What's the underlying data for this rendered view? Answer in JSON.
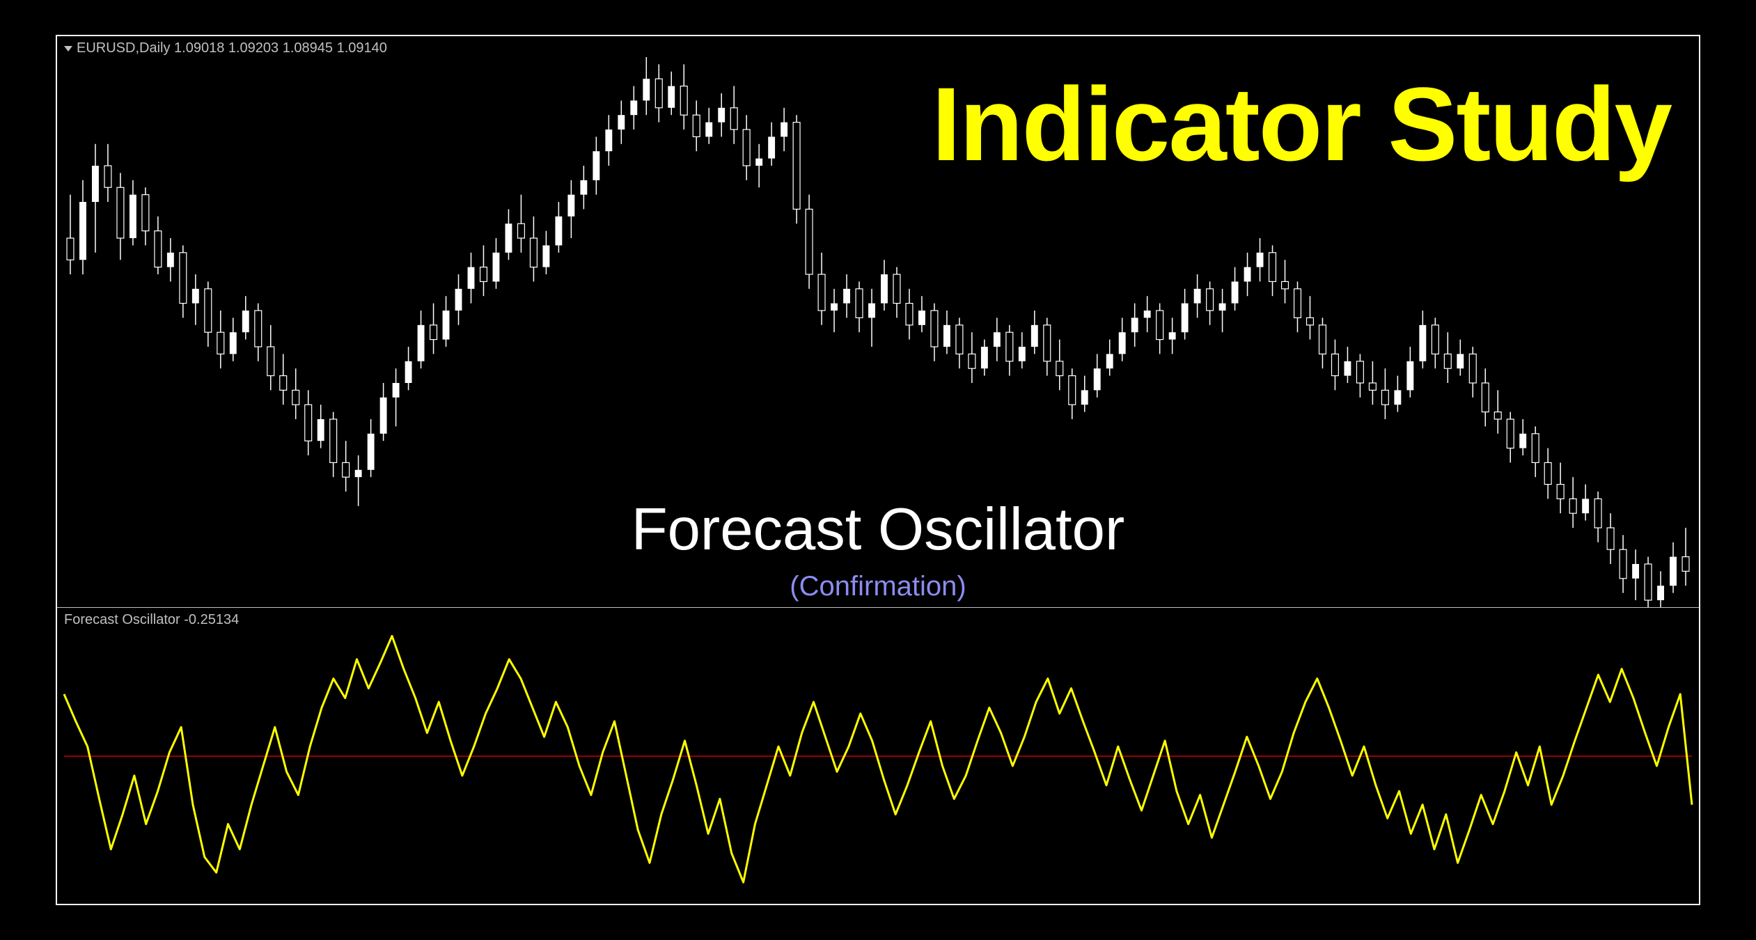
{
  "chart_data": {
    "type": "line",
    "title": "Indicator Study",
    "indicator_name": "Forecast Oscillator",
    "indicator_tag": "(Confirmation)",
    "price_pane": {
      "label": "EURUSD,Daily  1.09018 1.09203 1.08945 1.09140",
      "symbol": "EURUSD",
      "timeframe": "Daily",
      "ohlc": {
        "o": 1.09018,
        "h": 1.09203,
        "l": 1.08945,
        "c": 1.0914
      },
      "yrange_est": [
        1.05,
        1.125
      ],
      "candles": [
        {
          "o": 1.1,
          "h": 1.106,
          "l": 1.095,
          "c": 1.097
        },
        {
          "o": 1.097,
          "h": 1.108,
          "l": 1.095,
          "c": 1.105
        },
        {
          "o": 1.105,
          "h": 1.113,
          "l": 1.098,
          "c": 1.11
        },
        {
          "o": 1.11,
          "h": 1.113,
          "l": 1.105,
          "c": 1.107
        },
        {
          "o": 1.107,
          "h": 1.109,
          "l": 1.097,
          "c": 1.1
        },
        {
          "o": 1.1,
          "h": 1.108,
          "l": 1.099,
          "c": 1.106
        },
        {
          "o": 1.106,
          "h": 1.107,
          "l": 1.099,
          "c": 1.101
        },
        {
          "o": 1.101,
          "h": 1.103,
          "l": 1.095,
          "c": 1.096
        },
        {
          "o": 1.096,
          "h": 1.1,
          "l": 1.094,
          "c": 1.098
        },
        {
          "o": 1.098,
          "h": 1.099,
          "l": 1.089,
          "c": 1.091
        },
        {
          "o": 1.091,
          "h": 1.095,
          "l": 1.088,
          "c": 1.093
        },
        {
          "o": 1.093,
          "h": 1.094,
          "l": 1.085,
          "c": 1.087
        },
        {
          "o": 1.087,
          "h": 1.09,
          "l": 1.082,
          "c": 1.084
        },
        {
          "o": 1.084,
          "h": 1.089,
          "l": 1.083,
          "c": 1.087
        },
        {
          "o": 1.087,
          "h": 1.092,
          "l": 1.086,
          "c": 1.09
        },
        {
          "o": 1.09,
          "h": 1.091,
          "l": 1.083,
          "c": 1.085
        },
        {
          "o": 1.085,
          "h": 1.088,
          "l": 1.079,
          "c": 1.081
        },
        {
          "o": 1.081,
          "h": 1.084,
          "l": 1.077,
          "c": 1.079
        },
        {
          "o": 1.079,
          "h": 1.082,
          "l": 1.075,
          "c": 1.077
        },
        {
          "o": 1.077,
          "h": 1.079,
          "l": 1.07,
          "c": 1.072
        },
        {
          "o": 1.072,
          "h": 1.077,
          "l": 1.071,
          "c": 1.075
        },
        {
          "o": 1.075,
          "h": 1.076,
          "l": 1.067,
          "c": 1.069
        },
        {
          "o": 1.069,
          "h": 1.072,
          "l": 1.065,
          "c": 1.067
        },
        {
          "o": 1.067,
          "h": 1.07,
          "l": 1.063,
          "c": 1.068
        },
        {
          "o": 1.068,
          "h": 1.075,
          "l": 1.067,
          "c": 1.073
        },
        {
          "o": 1.073,
          "h": 1.08,
          "l": 1.072,
          "c": 1.078
        },
        {
          "o": 1.078,
          "h": 1.082,
          "l": 1.074,
          "c": 1.08
        },
        {
          "o": 1.08,
          "h": 1.085,
          "l": 1.079,
          "c": 1.083
        },
        {
          "o": 1.083,
          "h": 1.09,
          "l": 1.082,
          "c": 1.088
        },
        {
          "o": 1.088,
          "h": 1.091,
          "l": 1.084,
          "c": 1.086
        },
        {
          "o": 1.086,
          "h": 1.092,
          "l": 1.085,
          "c": 1.09
        },
        {
          "o": 1.09,
          "h": 1.095,
          "l": 1.088,
          "c": 1.093
        },
        {
          "o": 1.093,
          "h": 1.098,
          "l": 1.091,
          "c": 1.096
        },
        {
          "o": 1.096,
          "h": 1.099,
          "l": 1.092,
          "c": 1.094
        },
        {
          "o": 1.094,
          "h": 1.1,
          "l": 1.093,
          "c": 1.098
        },
        {
          "o": 1.098,
          "h": 1.104,
          "l": 1.097,
          "c": 1.102
        },
        {
          "o": 1.102,
          "h": 1.106,
          "l": 1.098,
          "c": 1.1
        },
        {
          "o": 1.1,
          "h": 1.103,
          "l": 1.094,
          "c": 1.096
        },
        {
          "o": 1.096,
          "h": 1.101,
          "l": 1.095,
          "c": 1.099
        },
        {
          "o": 1.099,
          "h": 1.105,
          "l": 1.098,
          "c": 1.103
        },
        {
          "o": 1.103,
          "h": 1.108,
          "l": 1.1,
          "c": 1.106
        },
        {
          "o": 1.106,
          "h": 1.11,
          "l": 1.104,
          "c": 1.108
        },
        {
          "o": 1.108,
          "h": 1.114,
          "l": 1.106,
          "c": 1.112
        },
        {
          "o": 1.112,
          "h": 1.117,
          "l": 1.11,
          "c": 1.115
        },
        {
          "o": 1.115,
          "h": 1.119,
          "l": 1.113,
          "c": 1.117
        },
        {
          "o": 1.117,
          "h": 1.121,
          "l": 1.115,
          "c": 1.119
        },
        {
          "o": 1.119,
          "h": 1.125,
          "l": 1.117,
          "c": 1.122
        },
        {
          "o": 1.122,
          "h": 1.124,
          "l": 1.116,
          "c": 1.118
        },
        {
          "o": 1.118,
          "h": 1.123,
          "l": 1.117,
          "c": 1.121
        },
        {
          "o": 1.121,
          "h": 1.124,
          "l": 1.115,
          "c": 1.117
        },
        {
          "o": 1.117,
          "h": 1.119,
          "l": 1.112,
          "c": 1.114
        },
        {
          "o": 1.114,
          "h": 1.118,
          "l": 1.113,
          "c": 1.116
        },
        {
          "o": 1.116,
          "h": 1.12,
          "l": 1.114,
          "c": 1.118
        },
        {
          "o": 1.118,
          "h": 1.121,
          "l": 1.113,
          "c": 1.115
        },
        {
          "o": 1.115,
          "h": 1.117,
          "l": 1.108,
          "c": 1.11
        },
        {
          "o": 1.11,
          "h": 1.113,
          "l": 1.107,
          "c": 1.111
        },
        {
          "o": 1.111,
          "h": 1.116,
          "l": 1.11,
          "c": 1.114
        },
        {
          "o": 1.114,
          "h": 1.118,
          "l": 1.112,
          "c": 1.116
        },
        {
          "o": 1.116,
          "h": 1.117,
          "l": 1.102,
          "c": 1.104
        },
        {
          "o": 1.104,
          "h": 1.106,
          "l": 1.093,
          "c": 1.095
        },
        {
          "o": 1.095,
          "h": 1.098,
          "l": 1.088,
          "c": 1.09
        },
        {
          "o": 1.09,
          "h": 1.093,
          "l": 1.087,
          "c": 1.091
        },
        {
          "o": 1.091,
          "h": 1.095,
          "l": 1.089,
          "c": 1.093
        },
        {
          "o": 1.093,
          "h": 1.094,
          "l": 1.087,
          "c": 1.089
        },
        {
          "o": 1.089,
          "h": 1.093,
          "l": 1.085,
          "c": 1.091
        },
        {
          "o": 1.091,
          "h": 1.097,
          "l": 1.09,
          "c": 1.095
        },
        {
          "o": 1.095,
          "h": 1.096,
          "l": 1.089,
          "c": 1.091
        },
        {
          "o": 1.091,
          "h": 1.093,
          "l": 1.086,
          "c": 1.088
        },
        {
          "o": 1.088,
          "h": 1.092,
          "l": 1.087,
          "c": 1.09
        },
        {
          "o": 1.09,
          "h": 1.091,
          "l": 1.083,
          "c": 1.085
        },
        {
          "o": 1.085,
          "h": 1.09,
          "l": 1.084,
          "c": 1.088
        },
        {
          "o": 1.088,
          "h": 1.089,
          "l": 1.082,
          "c": 1.084
        },
        {
          "o": 1.084,
          "h": 1.087,
          "l": 1.08,
          "c": 1.082
        },
        {
          "o": 1.082,
          "h": 1.086,
          "l": 1.081,
          "c": 1.085
        },
        {
          "o": 1.085,
          "h": 1.089,
          "l": 1.083,
          "c": 1.087
        },
        {
          "o": 1.087,
          "h": 1.088,
          "l": 1.081,
          "c": 1.083
        },
        {
          "o": 1.083,
          "h": 1.087,
          "l": 1.082,
          "c": 1.085
        },
        {
          "o": 1.085,
          "h": 1.09,
          "l": 1.084,
          "c": 1.088
        },
        {
          "o": 1.088,
          "h": 1.089,
          "l": 1.081,
          "c": 1.083
        },
        {
          "o": 1.083,
          "h": 1.086,
          "l": 1.079,
          "c": 1.081
        },
        {
          "o": 1.081,
          "h": 1.082,
          "l": 1.075,
          "c": 1.077
        },
        {
          "o": 1.077,
          "h": 1.081,
          "l": 1.076,
          "c": 1.079
        },
        {
          "o": 1.079,
          "h": 1.084,
          "l": 1.078,
          "c": 1.082
        },
        {
          "o": 1.082,
          "h": 1.086,
          "l": 1.081,
          "c": 1.084
        },
        {
          "o": 1.084,
          "h": 1.089,
          "l": 1.083,
          "c": 1.087
        },
        {
          "o": 1.087,
          "h": 1.091,
          "l": 1.085,
          "c": 1.089
        },
        {
          "o": 1.089,
          "h": 1.092,
          "l": 1.087,
          "c": 1.09
        },
        {
          "o": 1.09,
          "h": 1.091,
          "l": 1.084,
          "c": 1.086
        },
        {
          "o": 1.086,
          "h": 1.089,
          "l": 1.084,
          "c": 1.087
        },
        {
          "o": 1.087,
          "h": 1.093,
          "l": 1.086,
          "c": 1.091
        },
        {
          "o": 1.091,
          "h": 1.095,
          "l": 1.089,
          "c": 1.093
        },
        {
          "o": 1.093,
          "h": 1.094,
          "l": 1.088,
          "c": 1.09
        },
        {
          "o": 1.09,
          "h": 1.093,
          "l": 1.087,
          "c": 1.091
        },
        {
          "o": 1.091,
          "h": 1.096,
          "l": 1.09,
          "c": 1.094
        },
        {
          "o": 1.094,
          "h": 1.098,
          "l": 1.092,
          "c": 1.096
        },
        {
          "o": 1.096,
          "h": 1.1,
          "l": 1.094,
          "c": 1.098
        },
        {
          "o": 1.098,
          "h": 1.099,
          "l": 1.092,
          "c": 1.094
        },
        {
          "o": 1.094,
          "h": 1.097,
          "l": 1.091,
          "c": 1.093
        },
        {
          "o": 1.093,
          "h": 1.094,
          "l": 1.087,
          "c": 1.089
        },
        {
          "o": 1.089,
          "h": 1.092,
          "l": 1.086,
          "c": 1.088
        },
        {
          "o": 1.088,
          "h": 1.089,
          "l": 1.082,
          "c": 1.084
        },
        {
          "o": 1.084,
          "h": 1.086,
          "l": 1.079,
          "c": 1.081
        },
        {
          "o": 1.081,
          "h": 1.085,
          "l": 1.08,
          "c": 1.083
        },
        {
          "o": 1.083,
          "h": 1.084,
          "l": 1.078,
          "c": 1.08
        },
        {
          "o": 1.08,
          "h": 1.083,
          "l": 1.077,
          "c": 1.079
        },
        {
          "o": 1.079,
          "h": 1.082,
          "l": 1.075,
          "c": 1.077
        },
        {
          "o": 1.077,
          "h": 1.081,
          "l": 1.076,
          "c": 1.079
        },
        {
          "o": 1.079,
          "h": 1.085,
          "l": 1.078,
          "c": 1.083
        },
        {
          "o": 1.083,
          "h": 1.09,
          "l": 1.082,
          "c": 1.088
        },
        {
          "o": 1.088,
          "h": 1.089,
          "l": 1.082,
          "c": 1.084
        },
        {
          "o": 1.084,
          "h": 1.087,
          "l": 1.08,
          "c": 1.082
        },
        {
          "o": 1.082,
          "h": 1.086,
          "l": 1.081,
          "c": 1.084
        },
        {
          "o": 1.084,
          "h": 1.085,
          "l": 1.078,
          "c": 1.08
        },
        {
          "o": 1.08,
          "h": 1.082,
          "l": 1.074,
          "c": 1.076
        },
        {
          "o": 1.076,
          "h": 1.079,
          "l": 1.073,
          "c": 1.075
        },
        {
          "o": 1.075,
          "h": 1.076,
          "l": 1.069,
          "c": 1.071
        },
        {
          "o": 1.071,
          "h": 1.075,
          "l": 1.07,
          "c": 1.073
        },
        {
          "o": 1.073,
          "h": 1.074,
          "l": 1.067,
          "c": 1.069
        },
        {
          "o": 1.069,
          "h": 1.071,
          "l": 1.064,
          "c": 1.066
        },
        {
          "o": 1.066,
          "h": 1.069,
          "l": 1.062,
          "c": 1.064
        },
        {
          "o": 1.064,
          "h": 1.067,
          "l": 1.06,
          "c": 1.062
        },
        {
          "o": 1.062,
          "h": 1.066,
          "l": 1.061,
          "c": 1.064
        },
        {
          "o": 1.064,
          "h": 1.065,
          "l": 1.058,
          "c": 1.06
        },
        {
          "o": 1.06,
          "h": 1.062,
          "l": 1.055,
          "c": 1.057
        },
        {
          "o": 1.057,
          "h": 1.059,
          "l": 1.051,
          "c": 1.053
        },
        {
          "o": 1.053,
          "h": 1.057,
          "l": 1.05,
          "c": 1.055
        },
        {
          "o": 1.055,
          "h": 1.056,
          "l": 1.048,
          "c": 1.05
        },
        {
          "o": 1.05,
          "h": 1.054,
          "l": 1.049,
          "c": 1.052
        },
        {
          "o": 1.052,
          "h": 1.058,
          "l": 1.051,
          "c": 1.056
        },
        {
          "o": 1.056,
          "h": 1.06,
          "l": 1.052,
          "c": 1.054
        }
      ]
    },
    "indicator_pane": {
      "label": "Forecast Oscillator -0.25134",
      "name": "Forecast Oscillator",
      "current_value": -0.25134,
      "zero_line": 0,
      "yrange_est": [
        -0.7,
        0.65
      ],
      "values": [
        0.32,
        0.18,
        0.05,
        -0.22,
        -0.48,
        -0.3,
        -0.1,
        -0.35,
        -0.18,
        0.02,
        0.15,
        -0.25,
        -0.52,
        -0.6,
        -0.35,
        -0.48,
        -0.25,
        -0.05,
        0.15,
        -0.08,
        -0.2,
        0.05,
        0.25,
        0.4,
        0.3,
        0.5,
        0.35,
        0.48,
        0.62,
        0.45,
        0.3,
        0.12,
        0.28,
        0.08,
        -0.1,
        0.05,
        0.22,
        0.35,
        0.5,
        0.4,
        0.25,
        0.1,
        0.28,
        0.15,
        -0.05,
        -0.2,
        0.02,
        0.18,
        -0.1,
        -0.38,
        -0.55,
        -0.3,
        -0.12,
        0.08,
        -0.15,
        -0.4,
        -0.22,
        -0.5,
        -0.65,
        -0.35,
        -0.15,
        0.05,
        -0.1,
        0.12,
        0.28,
        0.1,
        -0.08,
        0.05,
        0.22,
        0.08,
        -0.12,
        -0.3,
        -0.15,
        0.02,
        0.18,
        -0.05,
        -0.22,
        -0.1,
        0.08,
        0.25,
        0.12,
        -0.05,
        0.1,
        0.28,
        0.4,
        0.22,
        0.35,
        0.18,
        0.02,
        -0.15,
        0.05,
        -0.12,
        -0.28,
        -0.1,
        0.08,
        -0.18,
        -0.35,
        -0.2,
        -0.42,
        -0.25,
        -0.08,
        0.1,
        -0.05,
        -0.22,
        -0.08,
        0.12,
        0.28,
        0.4,
        0.25,
        0.08,
        -0.1,
        0.05,
        -0.15,
        -0.32,
        -0.18,
        -0.4,
        -0.25,
        -0.48,
        -0.3,
        -0.55,
        -0.38,
        -0.2,
        -0.35,
        -0.18,
        0.02,
        -0.15,
        0.05,
        -0.25,
        -0.1,
        0.08,
        0.25,
        0.42,
        0.28,
        0.45,
        0.3,
        0.12,
        -0.05,
        0.15,
        0.32,
        -0.25
      ]
    }
  },
  "labels": {
    "price_pane": "EURUSD,Daily  1.09018 1.09203 1.08945 1.09140",
    "indicator_pane": "Forecast Oscillator -0.25134",
    "title": "Indicator Study",
    "center_title": "Forecast Oscillator",
    "center_sub": "(Confirmation)"
  }
}
